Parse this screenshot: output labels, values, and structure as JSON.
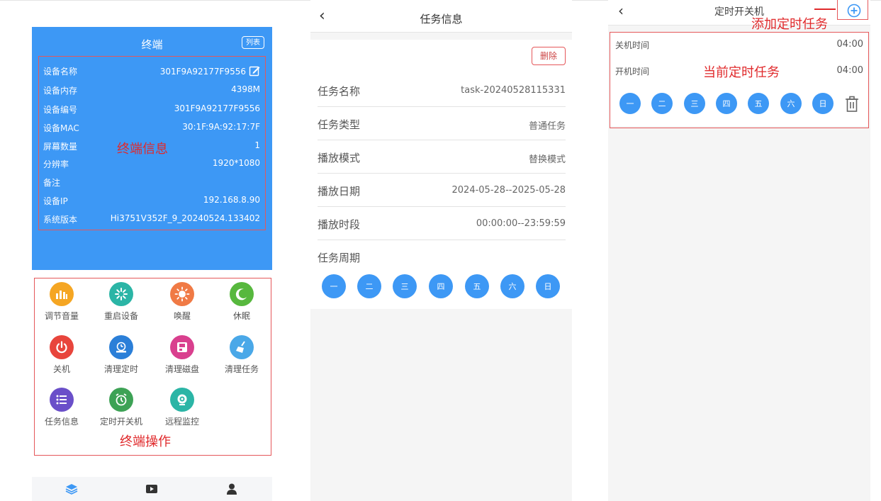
{
  "panel1": {
    "title": "终端",
    "list_button": "列表",
    "info": [
      {
        "label": "设备名称",
        "value": "301F9A92177F9556"
      },
      {
        "label": "设备内存",
        "value": "4398M"
      },
      {
        "label": "设备编号",
        "value": "301F9A92177F9556"
      },
      {
        "label": "设备MAC",
        "value": "30:1F:9A:92:17:7F"
      },
      {
        "label": "屏幕数量",
        "value": "1"
      },
      {
        "label": "分辨率",
        "value": "1920*1080"
      },
      {
        "label": "备注",
        "value": ""
      },
      {
        "label": "设备IP",
        "value": "192.168.8.90"
      },
      {
        "label": "系统版本",
        "value": "Hi3751V352F_9_20240524.133402"
      }
    ],
    "annotation_info": "终端信息",
    "annotation_ops": "终端操作",
    "operations": [
      {
        "label": "调节音量",
        "color": "#f5a623",
        "icon": "volume-bars-icon"
      },
      {
        "label": "重启设备",
        "color": "#2bb5a6",
        "icon": "restart-spinner-icon"
      },
      {
        "label": "唤醒",
        "color": "#f07a45",
        "icon": "sun-icon"
      },
      {
        "label": "休眠",
        "color": "#57b83e",
        "icon": "moon-sleep-icon"
      },
      {
        "label": "关机",
        "color": "#e8453c",
        "icon": "power-icon"
      },
      {
        "label": "清理定时",
        "color": "#2b7fd8",
        "icon": "clear-timer-icon"
      },
      {
        "label": "清理磁盘",
        "color": "#d93f8e",
        "icon": "disk-icon"
      },
      {
        "label": "清理任务",
        "color": "#4aa8e8",
        "icon": "broom-icon"
      },
      {
        "label": "任务信息",
        "color": "#6a4fc9",
        "icon": "list-icon"
      },
      {
        "label": "定时开关机",
        "color": "#3da255",
        "icon": "alarm-clock-icon"
      },
      {
        "label": "远程监控",
        "color": "#2bb5a6",
        "icon": "camera-icon"
      }
    ],
    "tabs": [
      "layers-icon",
      "play-icon",
      "user-icon"
    ]
  },
  "panel2": {
    "back": "‹",
    "title": "任务信息",
    "delete_button": "删除",
    "rows": [
      {
        "label": "任务名称",
        "value": "task-20240528115331"
      },
      {
        "label": "任务类型",
        "value": "普通任务"
      },
      {
        "label": "播放模式",
        "value": "替换模式"
      },
      {
        "label": "播放日期",
        "value": "2024-05-28--2025-05-28"
      },
      {
        "label": "播放时段",
        "value": "00:00:00--23:59:59"
      }
    ],
    "period_label": "任务周期",
    "days": [
      "一",
      "二",
      "三",
      "四",
      "五",
      "六",
      "日"
    ]
  },
  "panel3": {
    "back": "‹",
    "title": "定时开关机",
    "annotation_add": "添加定时任务",
    "annotation_current": "当前定时任务",
    "shutdown_label": "关机时间",
    "shutdown_time": "04:00",
    "startup_label": "开机时间",
    "startup_time": "04:00",
    "days": [
      "一",
      "二",
      "三",
      "四",
      "五",
      "六",
      "日"
    ]
  },
  "colors": {
    "primary_blue": "#3d98f5",
    "annotation_red": "#e0292b"
  }
}
